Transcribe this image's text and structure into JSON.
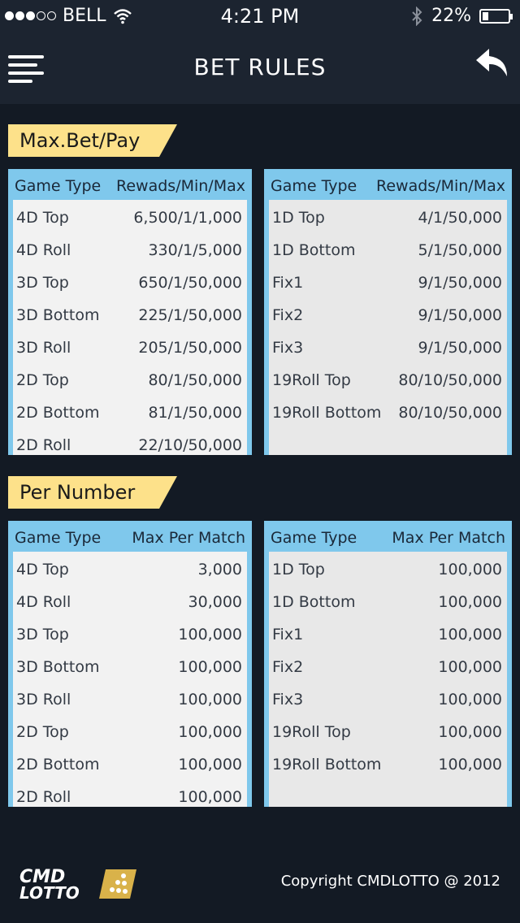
{
  "status_bar": {
    "carrier": "BELL",
    "time": "4:21 PM",
    "battery": "22%",
    "battery_level": 0.22
  },
  "header": {
    "title": "BET RULES",
    "menu_icon": "hamburger-menu-icon",
    "back_icon": "reply-arrow-icon"
  },
  "sections": {
    "max_bet": {
      "label": "Max.Bet/Pay",
      "left": {
        "col1": "Game Type",
        "col2": "Rewads/Min/Max",
        "rows": [
          [
            "4D Top",
            "6,500/1/1,000"
          ],
          [
            "4D Roll",
            "330/1/5,000"
          ],
          [
            "3D Top",
            "650/1/50,000"
          ],
          [
            "3D Bottom",
            "225/1/50,000"
          ],
          [
            "3D Roll",
            "205/1/50,000"
          ],
          [
            "2D Top",
            "80/1/50,000"
          ],
          [
            "2D Bottom",
            "81/1/50,000"
          ],
          [
            "2D Roll",
            "22/10/50,000"
          ]
        ]
      },
      "right": {
        "col1": "Game Type",
        "col2": "Rewads/Min/Max",
        "rows": [
          [
            "1D Top",
            "4/1/50,000"
          ],
          [
            "1D Bottom",
            "5/1/50,000"
          ],
          [
            "Fix1",
            "9/1/50,000"
          ],
          [
            "Fix2",
            "9/1/50,000"
          ],
          [
            "Fix3",
            "9/1/50,000"
          ],
          [
            "19Roll Top",
            "80/10/50,000"
          ],
          [
            "19Roll Bottom",
            "80/10/50,000"
          ]
        ]
      }
    },
    "per_number": {
      "label": "Per Number",
      "left": {
        "col1": "Game Type",
        "col2": "Max Per Match",
        "rows": [
          [
            "4D Top",
            "3,000"
          ],
          [
            "4D Roll",
            "30,000"
          ],
          [
            "3D Top",
            "100,000"
          ],
          [
            "3D Bottom",
            "100,000"
          ],
          [
            "3D Roll",
            "100,000"
          ],
          [
            "2D Top",
            "100,000"
          ],
          [
            "2D Bottom",
            "100,000"
          ],
          [
            "2D Roll",
            "100,000"
          ]
        ]
      },
      "right": {
        "col1": "Game Type",
        "col2": "Max Per Match",
        "rows": [
          [
            "1D Top",
            "100,000"
          ],
          [
            "1D Bottom",
            "100,000"
          ],
          [
            "Fix1",
            "100,000"
          ],
          [
            "Fix2",
            "100,000"
          ],
          [
            "Fix3",
            "100,000"
          ],
          [
            "19Roll Top",
            "100,000"
          ],
          [
            "19Roll Bottom",
            "100,000"
          ]
        ]
      }
    }
  },
  "footer": {
    "logo_line1": "CMD",
    "logo_line2": "LOTTO",
    "copyright": "Copyright CMDLOTTO @ 2012"
  },
  "colors": {
    "background": "#131a24",
    "header": "#1c2430",
    "tag": "#fde18a",
    "table_border": "#7fc8ec",
    "table_body": "#e8e8e8"
  }
}
